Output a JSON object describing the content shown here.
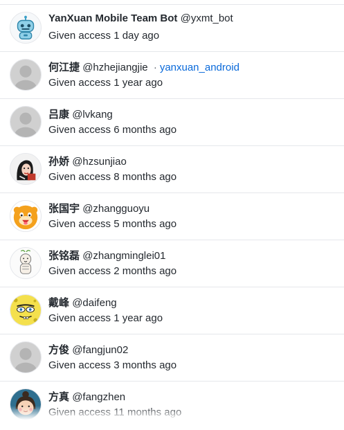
{
  "members": [
    {
      "name": "YanXuan Mobile Team Bot",
      "handle": "@yxmt_bot",
      "team": "",
      "access": "Given access 1 day ago",
      "avatar": "robot-avatar-icon"
    },
    {
      "name": "何江捷",
      "handle": "@hzhejiangjie",
      "team": "yanxuan_android",
      "access": "Given access 1 year ago",
      "avatar": "default-avatar-icon"
    },
    {
      "name": "吕康",
      "handle": "@lvkang",
      "team": "",
      "access": "Given access 6 months ago",
      "avatar": "default-avatar-icon"
    },
    {
      "name": "孙娇",
      "handle": "@hzsunjiao",
      "team": "",
      "access": "Given access 8 months ago",
      "avatar": "girl-portrait-avatar-icon"
    },
    {
      "name": "张国宇",
      "handle": "@zhangguoyu",
      "team": "",
      "access": "Given access 5 months ago",
      "avatar": "orange-cartoon-avatar-icon"
    },
    {
      "name": "张铭磊",
      "handle": "@zhangminglei01",
      "team": "",
      "access": "Given access 2 months ago",
      "avatar": "sketch-character-avatar-icon"
    },
    {
      "name": "戴峰",
      "handle": "@daifeng",
      "team": "",
      "access": "Given access 1 year ago",
      "avatar": "sponge-character-avatar-icon"
    },
    {
      "name": "方俊",
      "handle": "@fangjun02",
      "team": "",
      "access": "Given access 3 months ago",
      "avatar": "default-avatar-icon"
    },
    {
      "name": "方真",
      "handle": "@fangzhen",
      "team": "",
      "access": "Given access 11 months ago",
      "avatar": "cartoon-girl-avatar-icon"
    }
  ],
  "team_separator": "·",
  "colors": {
    "link": "#0969da",
    "text": "#24292f",
    "divider": "#e5e7eb"
  }
}
